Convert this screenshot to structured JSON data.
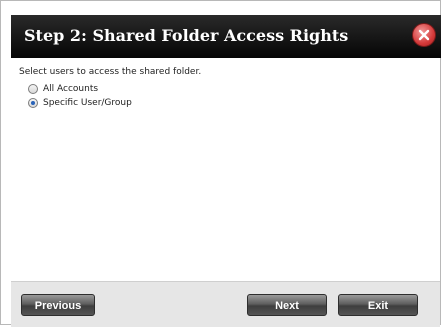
{
  "dialog": {
    "title": "Step 2: Shared Folder Access Rights",
    "instruction": "Select users to access the shared folder.",
    "options": [
      {
        "label": "All Accounts",
        "checked": false
      },
      {
        "label": "Specific User/Group",
        "checked": true
      }
    ]
  },
  "footer": {
    "previous_label": "Previous",
    "next_label": "Next",
    "exit_label": "Exit"
  },
  "colors": {
    "titlebar": "#0a0a0a",
    "close_button": "#d43a3a",
    "footer": "#e6e6e6",
    "radio_selected": "#2a63b8"
  },
  "icons": {
    "close": "close-x-icon"
  }
}
